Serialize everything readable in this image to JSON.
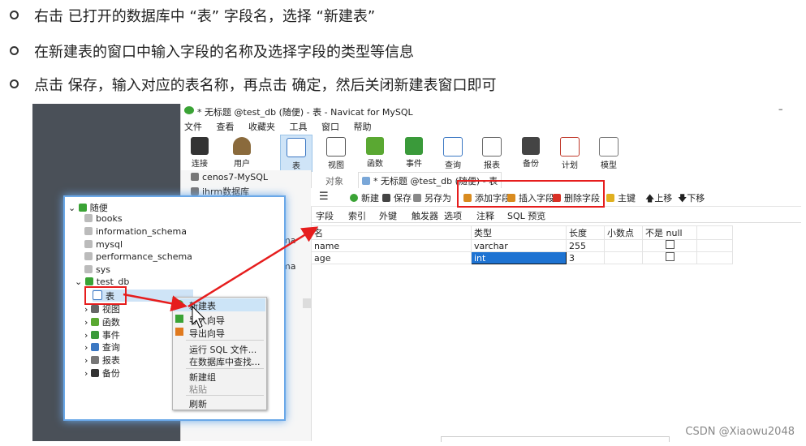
{
  "bullets": [
    "右击 已打开的数据库中 “表” 字段名，选择 “新建表”",
    "在新建表的窗口中输入字段的名称及选择字段的类型等信息",
    "点击 保存，输入对应的表名称，再点击 确定，然后关闭新建表窗口即可"
  ],
  "window": {
    "title": "* 无标题 @test_db (随便) - 表 - Navicat for MySQL",
    "close_glyph": "–",
    "menu": [
      "文件",
      "查看",
      "收藏夹",
      "工具",
      "窗口",
      "帮助"
    ],
    "toolbar": [
      {
        "label": "连接",
        "icon": "plug-icon"
      },
      {
        "label": "用户",
        "icon": "user-icon"
      },
      {
        "label": "表",
        "icon": "table-icon"
      },
      {
        "label": "视图",
        "icon": "view-icon"
      },
      {
        "label": "函数",
        "icon": "function-icon"
      },
      {
        "label": "事件",
        "icon": "event-icon"
      },
      {
        "label": "查询",
        "icon": "query-icon"
      },
      {
        "label": "报表",
        "icon": "report-icon"
      },
      {
        "label": "备份",
        "icon": "backup-icon"
      },
      {
        "label": "计划",
        "icon": "schedule-icon"
      },
      {
        "label": "模型",
        "icon": "model-icon"
      }
    ],
    "nav_items": [
      "cenos7-MySQL",
      "ihrm数据库"
    ],
    "nav_partial": [
      "ma",
      "ma"
    ],
    "tabs": {
      "objects": "对象",
      "doc": "* 无标题 @test_db (随便) - 表"
    },
    "edit_bar": {
      "new": "新建",
      "save": "保存",
      "save_as": "另存为",
      "add_field": "添加字段",
      "insert_field": "插入字段",
      "delete_field": "删除字段",
      "primary_key": "主键",
      "move_up": "上移",
      "move_down": "下移"
    },
    "subtabs": [
      "字段",
      "索引",
      "外键",
      "触发器",
      "选项",
      "注释",
      "SQL 预览"
    ],
    "grid": {
      "headers": [
        "名",
        "类型",
        "长度",
        "小数点",
        "不是 null"
      ],
      "rows": [
        {
          "name": "name",
          "type": "varchar",
          "length": "255",
          "decimals": ""
        },
        {
          "name": "age",
          "type": "int",
          "length": "3",
          "decimals": ""
        }
      ]
    }
  },
  "popup_tree": {
    "root": "随便",
    "databases": [
      "books",
      "information_schema",
      "mysql",
      "performance_schema",
      "sys"
    ],
    "open_db": "test_db",
    "children": [
      "表",
      "视图",
      "函数",
      "事件",
      "查询",
      "报表",
      "备份"
    ]
  },
  "context_menu": {
    "items": [
      "新建表",
      "导入向导",
      "导出向导",
      "运行 SQL 文件...",
      "在数据库中查找...",
      "新建组",
      "粘贴",
      "刷新"
    ]
  },
  "watermark": "CSDN @Xiaowu2048",
  "colors": {
    "highlight_red": "#e61d1d",
    "popup_glow": "#6aa8e8",
    "selected_cell": "#1e73d2",
    "menu_hover": "#cce4f7"
  }
}
